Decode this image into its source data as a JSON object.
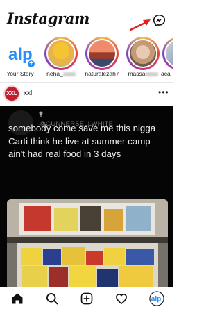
{
  "header": {
    "logo_text": "Instagram",
    "messenger_icon": "messenger-icon",
    "annotation_color": "#e02020"
  },
  "stories": [
    {
      "name": "Your Story",
      "kind": "own"
    },
    {
      "name": "neha_",
      "kind": "unseen"
    },
    {
      "name": "naturalezah7",
      "kind": "unseen"
    },
    {
      "name": "massa",
      "kind": "unseen"
    },
    {
      "name": "aca",
      "kind": "unseen"
    }
  ],
  "post": {
    "username": "xxl",
    "avatar_text": "XXL",
    "more_label": "•••",
    "tweet": {
      "name": "🕈",
      "handle": "@GUNNERSELLWHITE",
      "text": "somebody come save me this nigga Carti think he live at summer camp ain't had real food in 3 days"
    }
  },
  "nav": {
    "icons": [
      "home-icon",
      "search-icon",
      "new-post-icon",
      "activity-heart-icon",
      "profile-icon"
    ]
  },
  "colors": {
    "story_ring": [
      "#f6c24f",
      "#e8463f",
      "#c2338f",
      "#7f43c6"
    ],
    "add_story": "#2a8ff5",
    "xxl_red": "#c21f2e"
  }
}
